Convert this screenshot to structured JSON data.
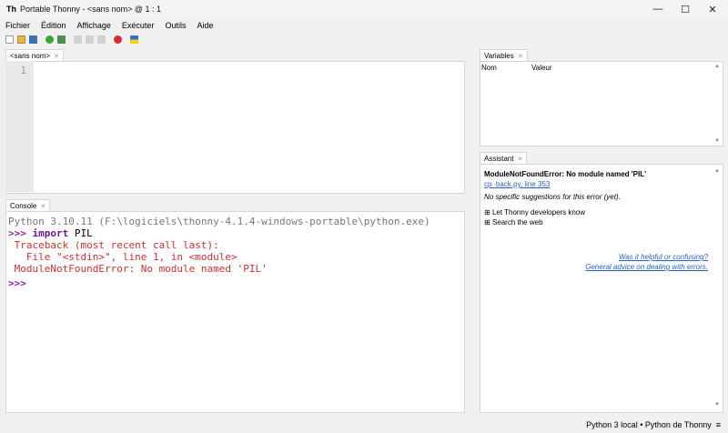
{
  "window": {
    "title": "Portable Thonny  -  <sans nom>  @  1 : 1",
    "minimize": "—",
    "maximize": "☐",
    "close": "✕"
  },
  "menu": [
    "Fichier",
    "Édition",
    "Affichage",
    "Exécuter",
    "Outils",
    "Aide"
  ],
  "editor": {
    "tab": "<sans nom>",
    "line_number": "1"
  },
  "variables": {
    "tab": "Variables",
    "col_name": "Nom",
    "col_value": "Valeur"
  },
  "console": {
    "tab": "Console",
    "banner": "Python 3.10.11 (F:\\logiciels\\thonny-4.1.4-windows-portable\\python.exe)",
    "prompt": ">>>",
    "keyword": "import",
    "command_rest": " PIL",
    "traceback": [
      " Traceback (most recent call last):",
      "   File \"<stdin>\", line 1, in <module>",
      " ModuleNotFoundError: No module named 'PIL'"
    ],
    "prompt2": ">>>"
  },
  "assistant": {
    "tab": "Assistant",
    "heading": "ModuleNotFoundError: No module named 'PIL'",
    "link": "cp_back.py, line 353",
    "note": "No specific suggestions for this error (yet).",
    "items": [
      "Let Thonny developers know",
      "Search the web"
    ],
    "feedback_1": "Was it helpful or confusing?",
    "feedback_2": "General advice on dealing with errors."
  },
  "status": {
    "interpreter": "Python 3 local  •  Python de Thonny",
    "menu_icon": "≡"
  }
}
